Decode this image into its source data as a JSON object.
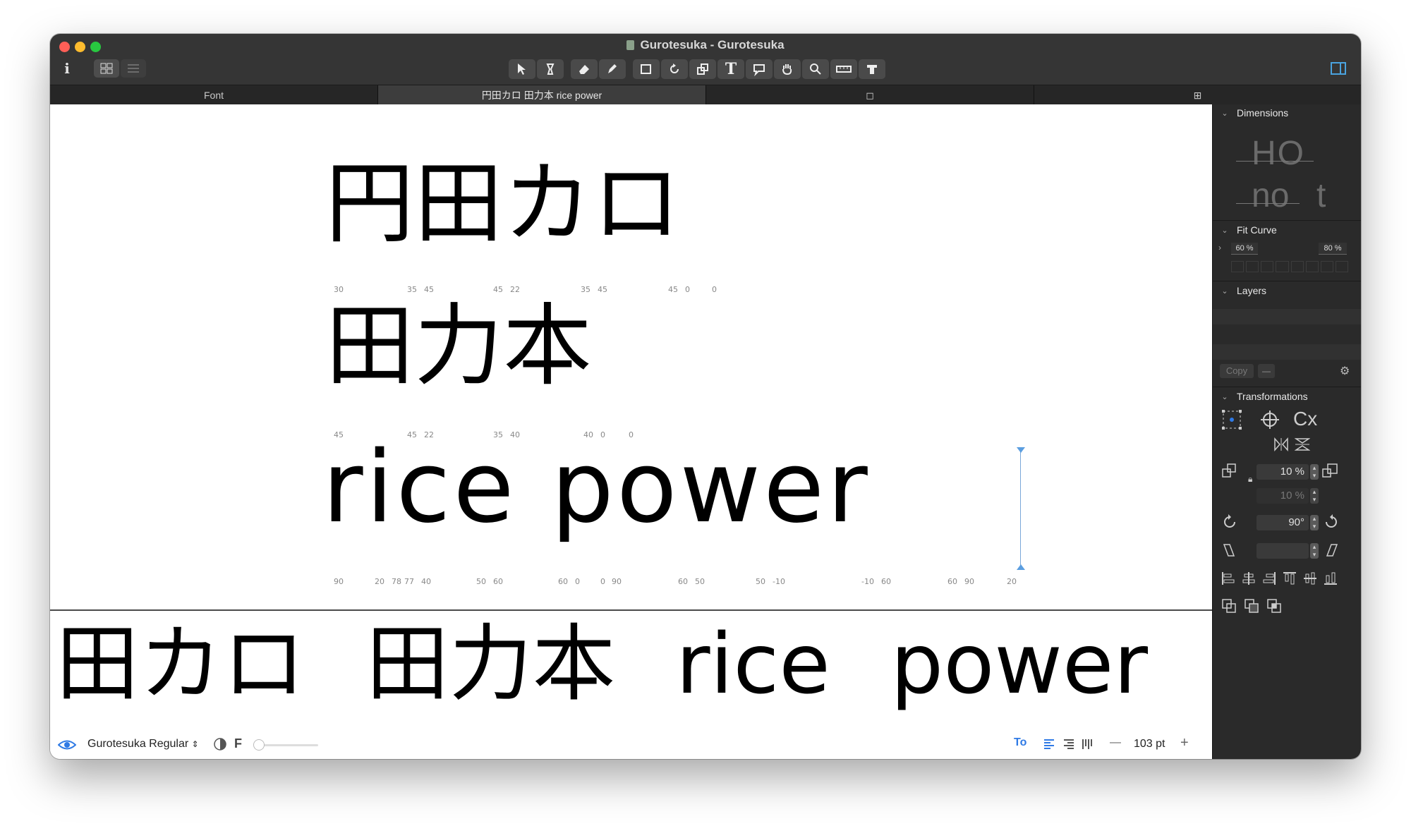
{
  "window": {
    "title": "Gurotesuka - Gurotesuka"
  },
  "toolbar": {
    "info_label": "i",
    "text_tool_label": "T"
  },
  "tabs": [
    {
      "label": "Font"
    },
    {
      "label": "円田カロ 田力本 rice power"
    },
    {
      "label": "◻"
    },
    {
      "label": "⊞"
    }
  ],
  "canvas": {
    "lines": [
      {
        "text": "円田カロ",
        "metrics": [
          "30",
          "35",
          "45",
          "45",
          "22",
          "35",
          "45",
          "45",
          "0",
          "0"
        ]
      },
      {
        "text": "田力本",
        "metrics": [
          "45",
          "45",
          "22",
          "35",
          "40",
          "40",
          "0",
          "0"
        ]
      },
      {
        "text": "rice power",
        "metrics": [
          "90",
          "20",
          "78",
          "77",
          "40",
          "50",
          "60",
          "60",
          "0",
          "0",
          "90",
          "60",
          "50",
          "50",
          "-10",
          "-10",
          "60",
          "60",
          "90",
          "20"
        ]
      }
    ]
  },
  "preview": {
    "text": "円田カロ 田力本 rice power"
  },
  "footer": {
    "font_name": "Gurotesuka Regular",
    "f_label": "F",
    "to_label": "To",
    "size_label": "103 pt",
    "minus": "—",
    "plus": "+"
  },
  "sidebar": {
    "dimensions": {
      "title": "Dimensions",
      "sample_upper": "HO",
      "sample_lower": "no",
      "sample_t": "t"
    },
    "fit_curve": {
      "title": "Fit Curve",
      "left_value": "60 %",
      "right_value": "80 %"
    },
    "layers": {
      "title": "Layers",
      "copy_label": "Copy",
      "minus_label": "—"
    },
    "transformations": {
      "title": "Transformations",
      "cx_label": "Cx",
      "scale_x": "10 %",
      "scale_y": "10 %",
      "rotate": "90°",
      "slant": ""
    }
  },
  "colors": {
    "titlebar": "#353535",
    "sidebar": "#2a2a2a",
    "accent": "#2f7ae5",
    "close": "#ff5f57",
    "minimize": "#febc2e",
    "zoom": "#28c840"
  }
}
